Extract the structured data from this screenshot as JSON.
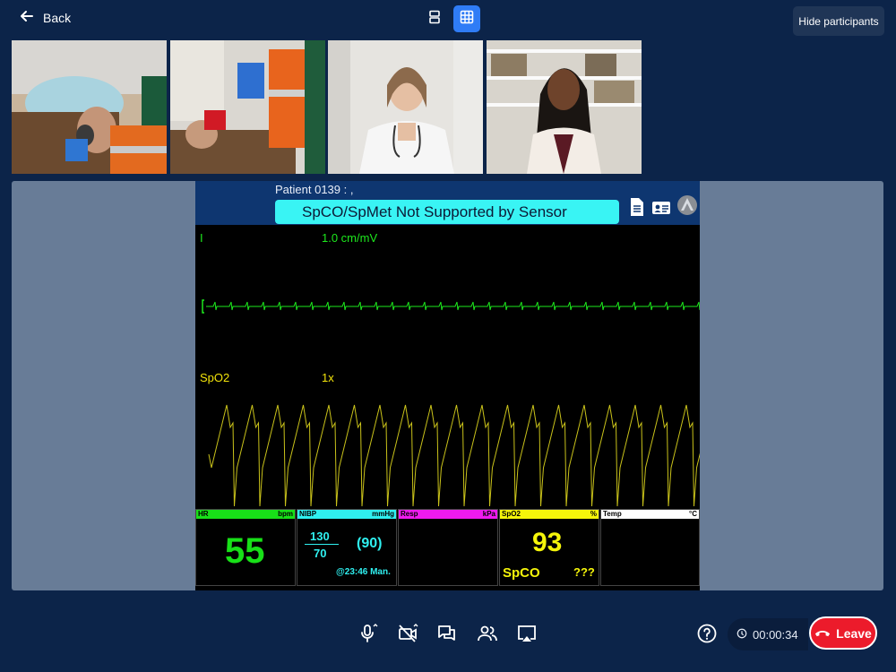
{
  "topbar": {
    "back_label": "Back",
    "hide_participants_label": "Hide participants"
  },
  "participants": [
    {
      "description_icon": "video-tile"
    },
    {
      "description_icon": "video-tile"
    },
    {
      "description_icon": "video-tile"
    },
    {
      "description_icon": "video-tile"
    }
  ],
  "monitor": {
    "patient": "Patient 0139 : ,",
    "alarm": "SpCO/SpMet Not Supported by Sensor",
    "ecg_lead": "I",
    "ecg_scale": "1.0 cm/mV",
    "pleth_label": "SpO2",
    "pleth_scale": "1x",
    "panels": {
      "hr": {
        "label": "HR",
        "unit": "bpm",
        "value": "55",
        "color": "#18e018"
      },
      "nibp": {
        "label": "NIBP",
        "unit": "mmHg",
        "systolic": "130",
        "diastolic": "70",
        "mean": "(90)",
        "time": "@23:46 Man.",
        "color": "#2ff0f0"
      },
      "resp": {
        "label": "Resp",
        "unit": "kPa",
        "color": "#f01af0"
      },
      "spo2": {
        "label": "SpO2",
        "unit": "%",
        "value": "93",
        "spco_label": "SpCO",
        "spco_value": "???",
        "color": "#f5f50a"
      },
      "temp": {
        "label": "Temp",
        "unit": "°C",
        "color": "#ffffff"
      }
    }
  },
  "controls": {
    "timer": "00:00:34",
    "leave_label": "Leave"
  }
}
